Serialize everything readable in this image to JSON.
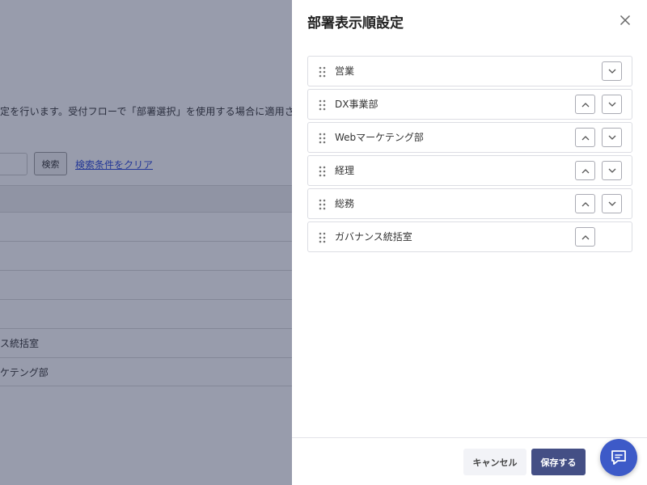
{
  "background": {
    "description": "定を行います。受付フローで「部署選択」を使用する場合に適用されます。",
    "search_button": "検索",
    "clear_link": "検索条件をクリア",
    "rows": [
      "",
      "",
      "",
      "",
      "",
      "ス統括室",
      "ケテング部"
    ]
  },
  "drawer": {
    "title": "部署表示順設定",
    "close_icon": "close-icon",
    "items": [
      {
        "name": "営業",
        "can_move_up": false,
        "can_move_down": true
      },
      {
        "name": "DX事業部",
        "can_move_up": true,
        "can_move_down": true
      },
      {
        "name": "Webマーケテング部",
        "can_move_up": true,
        "can_move_down": true
      },
      {
        "name": "経理",
        "can_move_up": true,
        "can_move_down": true
      },
      {
        "name": "総務",
        "can_move_up": true,
        "can_move_down": true
      },
      {
        "name": "ガバナンス統括室",
        "can_move_up": true,
        "can_move_down": false
      }
    ],
    "cancel_label": "キャンセル",
    "save_label": "保存する"
  },
  "chat": {
    "icon": "chat-bubble-icon"
  },
  "colors": {
    "primary": "#444f85",
    "chat": "#3d5ac8",
    "overlay": "#1e284b"
  }
}
